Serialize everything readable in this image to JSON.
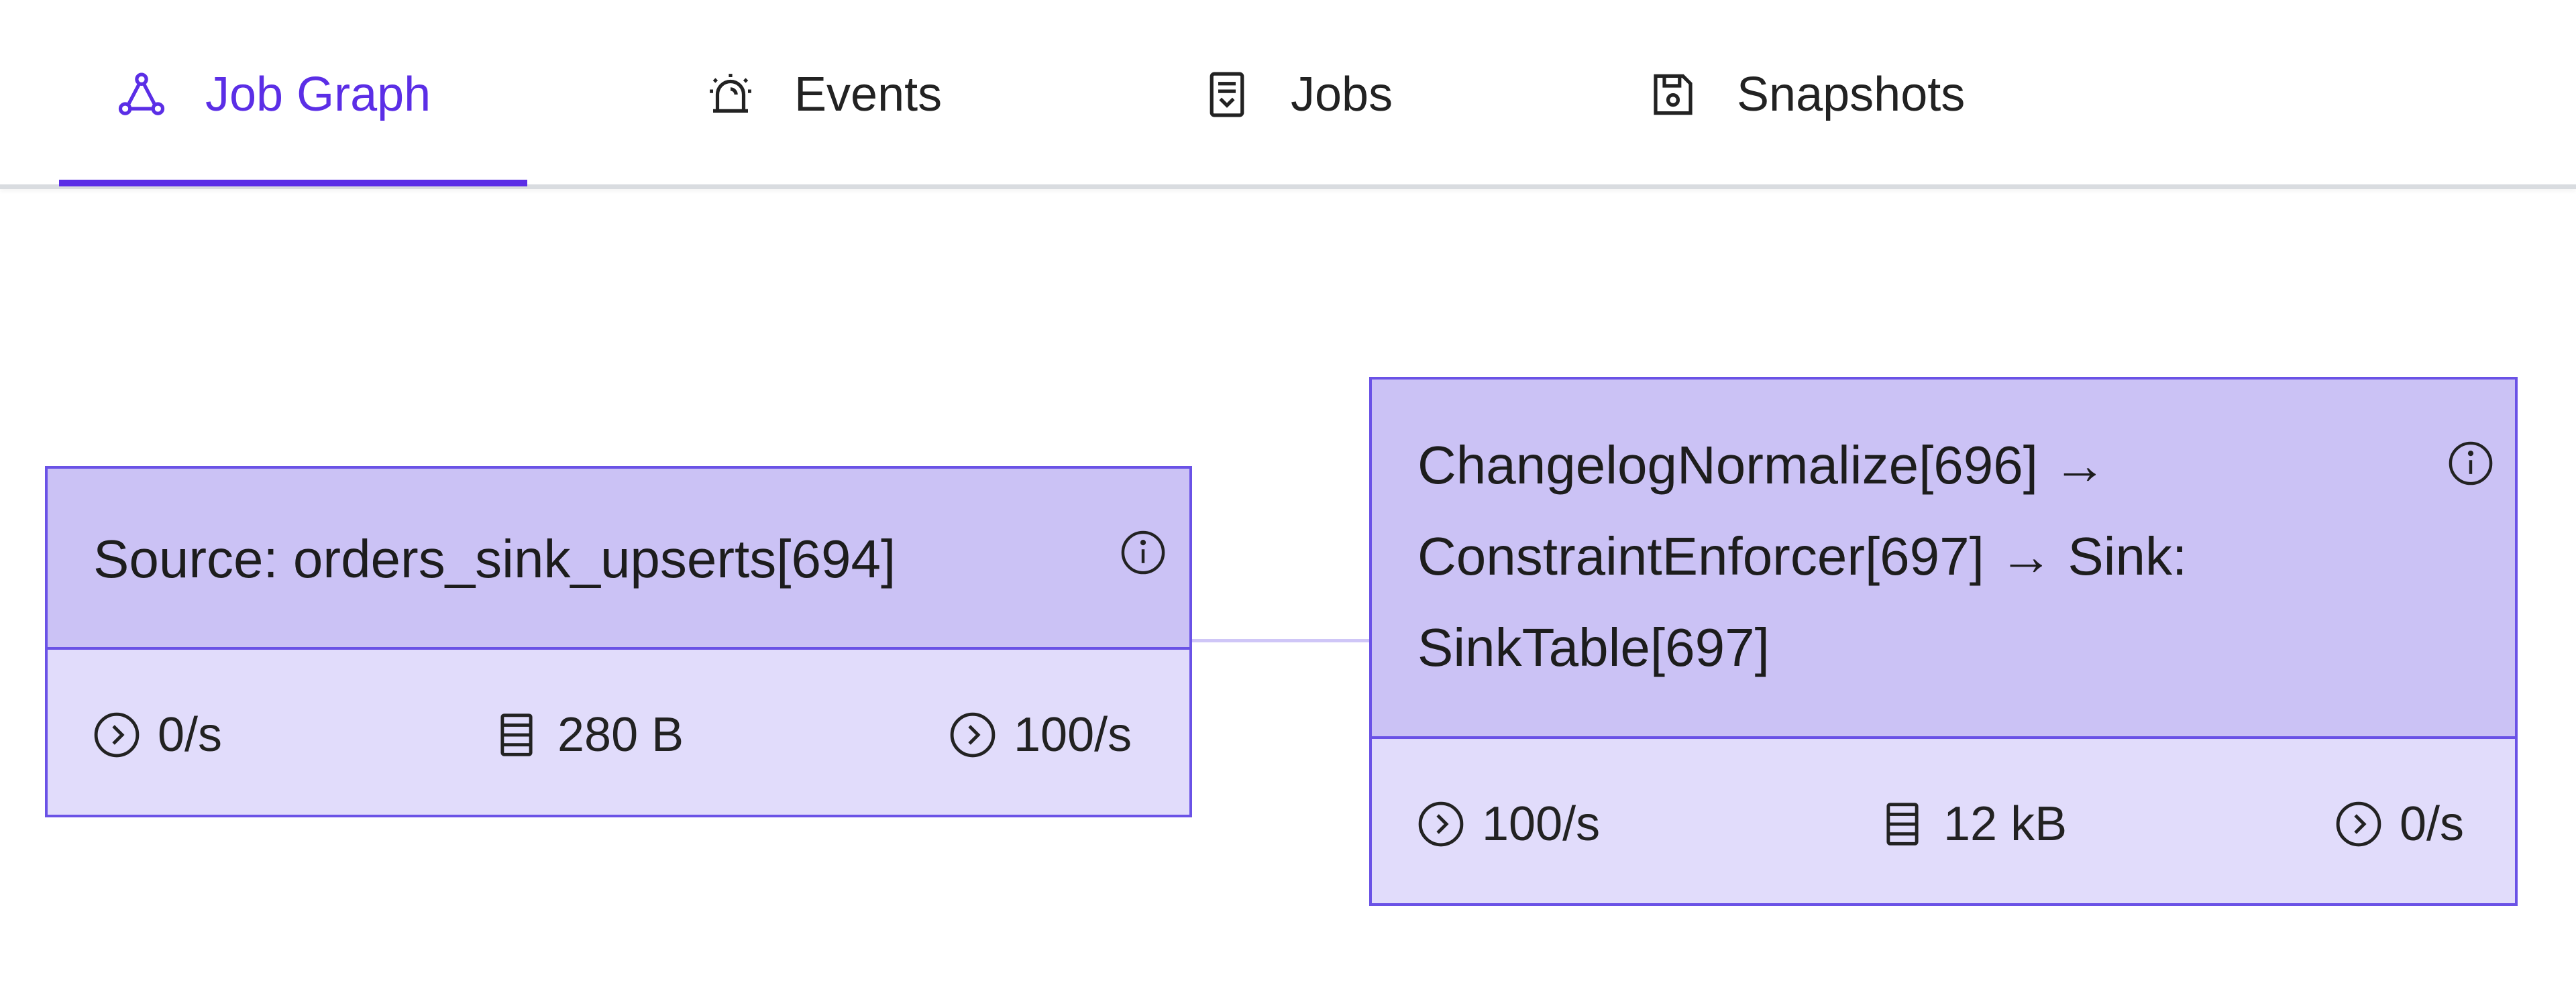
{
  "tabs": [
    {
      "label": "Job Graph",
      "icon": "graph-icon",
      "active": true
    },
    {
      "label": "Events",
      "icon": "alarm-icon",
      "active": false
    },
    {
      "label": "Jobs",
      "icon": "jobs-list-icon",
      "active": false
    },
    {
      "label": "Snapshots",
      "icon": "save-icon",
      "active": false
    }
  ],
  "colors": {
    "accent": "#5b2ee6",
    "node_border": "#6a52e6",
    "node_header": "#cbc2f5",
    "node_body": "#e1dcfb"
  },
  "nodes": [
    {
      "title": "Source: orders_sink_upserts[694]",
      "metrics": {
        "in_rate": "0/s",
        "state_size": "280 B",
        "out_rate": "100/s"
      }
    },
    {
      "title_lines": [
        "ChangelogNormalize[696] →",
        "ConstraintEnforcer[697] → Sink:",
        "SinkTable[697]"
      ],
      "metrics": {
        "in_rate": "100/s",
        "state_size": "12 kB",
        "out_rate": "0/s"
      }
    }
  ]
}
